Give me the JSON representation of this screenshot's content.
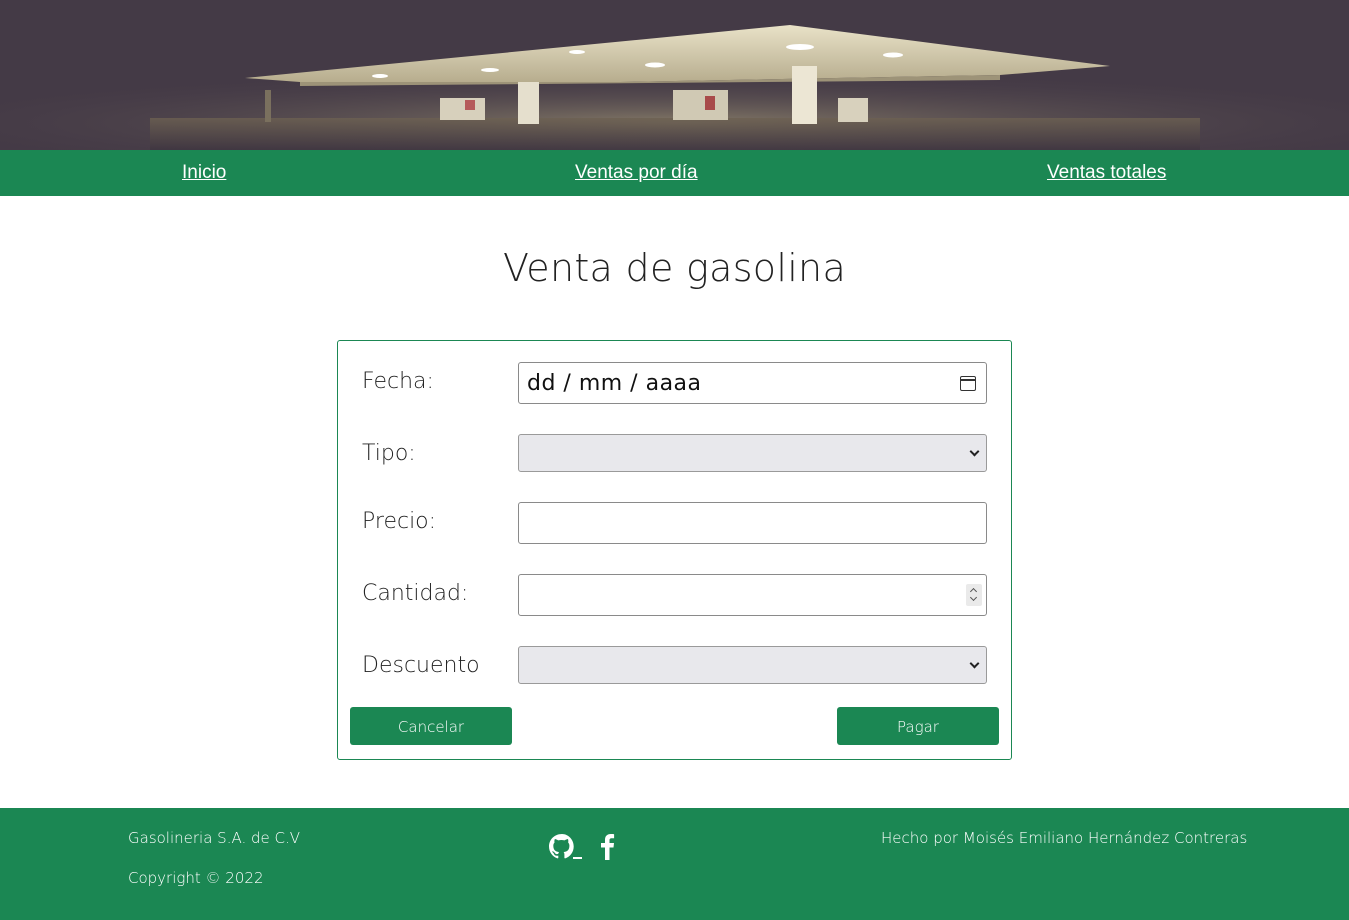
{
  "nav": {
    "items": [
      {
        "label": "Inicio"
      },
      {
        "label": "Ventas por día"
      },
      {
        "label": "Ventas totales"
      }
    ]
  },
  "page": {
    "title": "Venta de gasolina"
  },
  "form": {
    "fecha_label": "Fecha:",
    "fecha_value": "dd / mm / aaaa",
    "tipo_label": "Tipo:",
    "tipo_value": "",
    "precio_label": "Precio:",
    "precio_value": "",
    "cantidad_label": "Cantidad:",
    "cantidad_value": "",
    "descuento_label": "Descuento",
    "descuento_value": "",
    "cancel_label": "Cancelar",
    "pay_label": "Pagar"
  },
  "footer": {
    "company": "Gasolineria S.A. de C.V",
    "copyright": "Copyright © 2022",
    "author": "Hecho por Moisés Emiliano Hernández Contreras",
    "icons": [
      "github-icon",
      "facebook-icon"
    ]
  },
  "colors": {
    "brand_green": "#1b8753",
    "banner_bg": "#443a46"
  }
}
